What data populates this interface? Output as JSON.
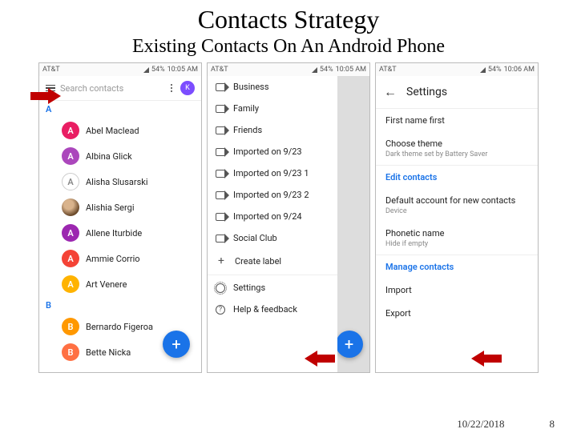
{
  "slide": {
    "title": "Contacts Strategy",
    "subtitle": "Existing Contacts On An Android Phone",
    "date": "10/22/2018",
    "page": "8"
  },
  "statusbar": {
    "carrier": "AT&T",
    "battery": "54%",
    "time1": "10:05 AM",
    "time2": "10:05 AM",
    "time3": "10:06 AM"
  },
  "screen1": {
    "search_placeholder": "Search contacts",
    "avatar_letter": "K",
    "sections": [
      {
        "letter": "A",
        "letter_color": "#1a73e8",
        "rows": [
          {
            "name": "Abel Maclead",
            "color": "#e91e63",
            "letter": "A"
          },
          {
            "name": "Albina Glick",
            "color": "#ab47bc",
            "letter": "A"
          },
          {
            "name": "Alisha Slusarski",
            "color": "#ffffff",
            "letter": "A",
            "outline": true
          },
          {
            "name": "Alishia Sergi",
            "photo": true
          },
          {
            "name": "Allene Iturbide",
            "color": "#9c27b0",
            "letter": "A"
          },
          {
            "name": "Ammie Corrio",
            "color": "#f44336",
            "letter": "A"
          },
          {
            "name": "Art Venere",
            "color": "#ffb300",
            "letter": "A"
          }
        ]
      },
      {
        "letter": "B",
        "letter_color": "#1a73e8",
        "rows": [
          {
            "name": "Bernardo Figeroa",
            "color": "#ff9800",
            "letter": "B"
          },
          {
            "name": "Bette Nicka",
            "color": "#ff7043",
            "letter": "B"
          }
        ]
      }
    ],
    "fab_label": "+"
  },
  "screen2": {
    "labels": [
      "Business",
      "Family",
      "Friends",
      "Imported on 9/23",
      "Imported on 9/23 1",
      "Imported on 9/23 2",
      "Imported on 9/24",
      "Social Club"
    ],
    "create_label": "Create label",
    "settings": "Settings",
    "help": "Help & feedback",
    "fab_label": "+"
  },
  "screen3": {
    "title": "Settings",
    "sort": {
      "l1": "First name first"
    },
    "theme": {
      "l1": "Choose theme",
      "l2": "Dark theme set by Battery Saver"
    },
    "edit_link": "Edit contacts",
    "default_acct": {
      "l1": "Default account for new contacts",
      "l2": "Device"
    },
    "phonetic": {
      "l1": "Phonetic name",
      "l2": "Hide if empty"
    },
    "manage_link": "Manage contacts",
    "import": "Import",
    "export": "Export"
  }
}
